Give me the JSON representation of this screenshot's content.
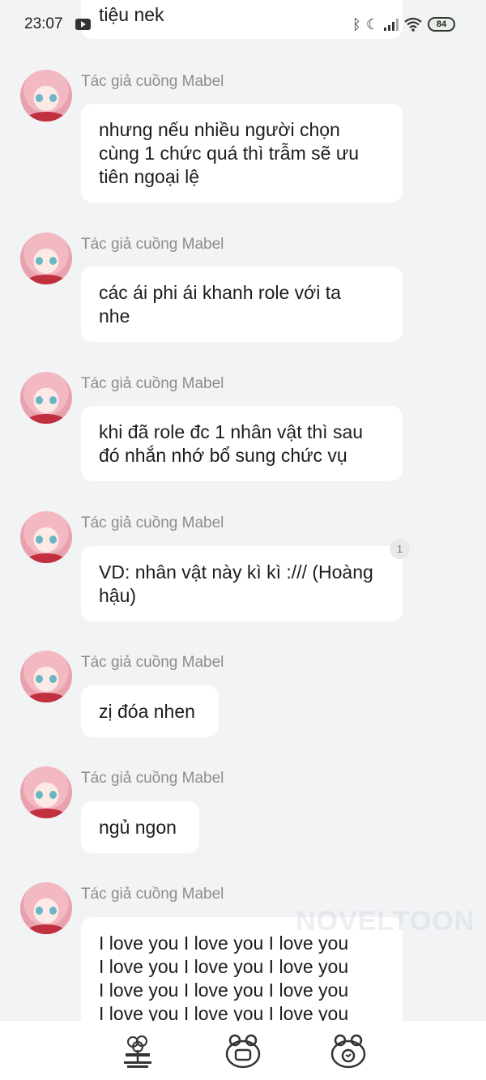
{
  "status_bar": {
    "time": "23:07",
    "icons": [
      "youtube-icon",
      "bluetooth-icon",
      "moon-icon",
      "signal-icon",
      "wifi-icon"
    ],
    "battery": "84"
  },
  "messages": [
    {
      "author": "",
      "text": "tiệu nek",
      "partial": true
    },
    {
      "author": "Tác giả cuồng Mabel",
      "lines": [
        "nhưng nếu nhiều người chọn",
        "cùng 1 chức quá thì trẫm sẽ ưu",
        "tiên ngoại lệ"
      ]
    },
    {
      "author": "Tác giả cuồng Mabel",
      "lines": [
        "các ái phi ái khanh role với ta",
        "nhe"
      ]
    },
    {
      "author": "Tác giả cuồng Mabel",
      "lines": [
        "khi đã role đc 1 nhân vật thì sau",
        "đó nhắn nhớ bổ sung chức vụ"
      ]
    },
    {
      "author": "Tác giả cuồng Mabel",
      "lines": [
        "VD: nhân vật này kì kì :/// (Hoàng",
        "hậu)"
      ],
      "badge": "1"
    },
    {
      "author": "Tác giả cuồng Mabel",
      "lines": [
        "zị đóa nhen"
      ]
    },
    {
      "author": "Tác giả cuồng Mabel",
      "lines": [
        "ngủ ngon"
      ]
    },
    {
      "author": "Tác giả cuồng Mabel",
      "lines": [
        "I love you I love you I love you",
        "I love you I love you I love you",
        "I love you I love you I love you",
        "I love you I love you I love you"
      ]
    }
  ],
  "watermark": "NOVELTOON",
  "bottom_nav": {
    "items": [
      {
        "icon": "tree-icon"
      },
      {
        "icon": "frog-tv-icon"
      },
      {
        "icon": "frog-chat-icon"
      }
    ]
  },
  "colors": {
    "background": "#f2f3f5",
    "bubble": "#ffffff",
    "author_text": "#8d8d8d",
    "message_text": "#1c1c1c"
  }
}
